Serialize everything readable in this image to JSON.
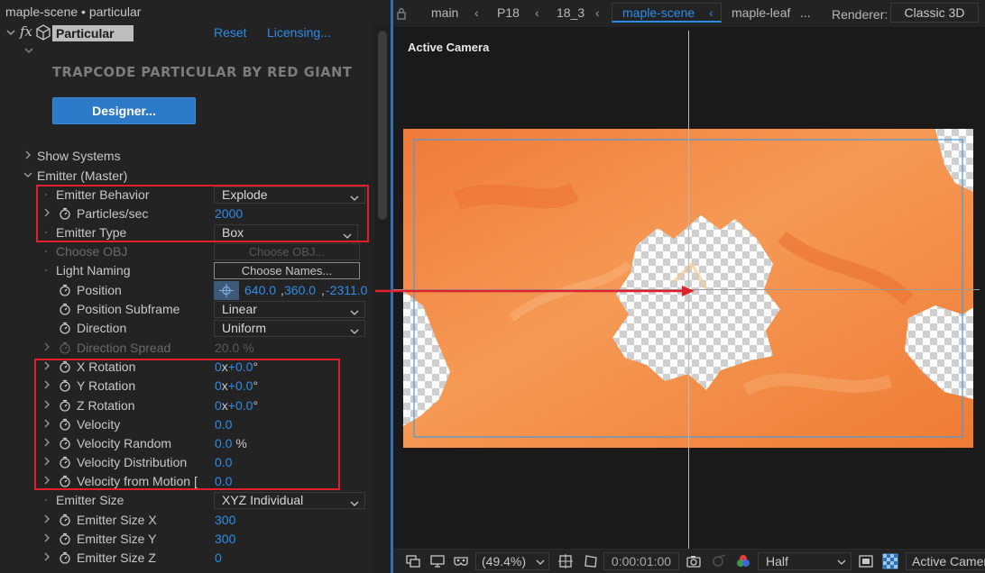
{
  "panel": {
    "title": "maple-scene • particular"
  },
  "effect": {
    "fx_label": "fx",
    "name": "Particular",
    "reset": "Reset",
    "licensing": "Licensing..."
  },
  "banner": {
    "text": "TRAPCODE PARTICULAR BY RED GIANT",
    "designer_button": "Designer..."
  },
  "groups": {
    "show_systems": "Show Systems",
    "emitter_master": "Emitter (Master)"
  },
  "props": {
    "emitter_behavior": {
      "label": "Emitter Behavior",
      "value": "Explode"
    },
    "particles_sec": {
      "label": "Particles/sec",
      "value": "2000"
    },
    "emitter_type": {
      "label": "Emitter Type",
      "value": "Box"
    },
    "choose_obj": {
      "label": "Choose OBJ",
      "button": "Choose OBJ..."
    },
    "light_naming": {
      "label": "Light Naming",
      "button": "Choose Names..."
    },
    "position": {
      "label": "Position",
      "x": "640.0",
      "y": "360.0",
      "z": "-2311.0"
    },
    "position_subframe": {
      "label": "Position Subframe",
      "value": "Linear"
    },
    "direction": {
      "label": "Direction",
      "value": "Uniform"
    },
    "direction_spread": {
      "label": "Direction Spread",
      "value": "20.0",
      "unit": "%"
    },
    "x_rotation": {
      "label": "X Rotation",
      "turns": "0",
      "x": "x",
      "degrees": "+0.0",
      "deg_sign": "°"
    },
    "y_rotation": {
      "label": "Y Rotation",
      "turns": "0",
      "x": "x",
      "degrees": "+0.0",
      "deg_sign": "°"
    },
    "z_rotation": {
      "label": "Z Rotation",
      "turns": "0",
      "x": "x",
      "degrees": "+0.0",
      "deg_sign": "°"
    },
    "velocity": {
      "label": "Velocity",
      "value": "0.0"
    },
    "velocity_random": {
      "label": "Velocity Random",
      "value": "0.0",
      "unit": "%"
    },
    "velocity_distribution": {
      "label": "Velocity Distribution",
      "value": "0.0"
    },
    "velocity_from_motion": {
      "label": "Velocity from Motion [",
      "value": "0.0"
    },
    "emitter_size": {
      "label": "Emitter Size",
      "value": "XYZ Individual"
    },
    "emitter_size_x": {
      "label": "Emitter Size X",
      "value": "300"
    },
    "emitter_size_y": {
      "label": "Emitter Size Y",
      "value": "300"
    },
    "emitter_size_z": {
      "label": "Emitter Size Z",
      "value": "0"
    }
  },
  "viewer": {
    "tabs": [
      "main",
      "P18",
      "18_3",
      "maple-scene",
      "maple-leaf"
    ],
    "more": "...",
    "renderer_label": "Renderer:",
    "renderer_value": "Classic 3D",
    "camera_label": "Active Camera",
    "zoom": "(49.4%)",
    "timecode": "0:00:01:00",
    "resolution": "Half",
    "view": "Active Camera"
  },
  "colors": {
    "accent": "#2d8ceb",
    "highlight_box": "#e0202a",
    "leaf_orange": "#f2883e"
  }
}
